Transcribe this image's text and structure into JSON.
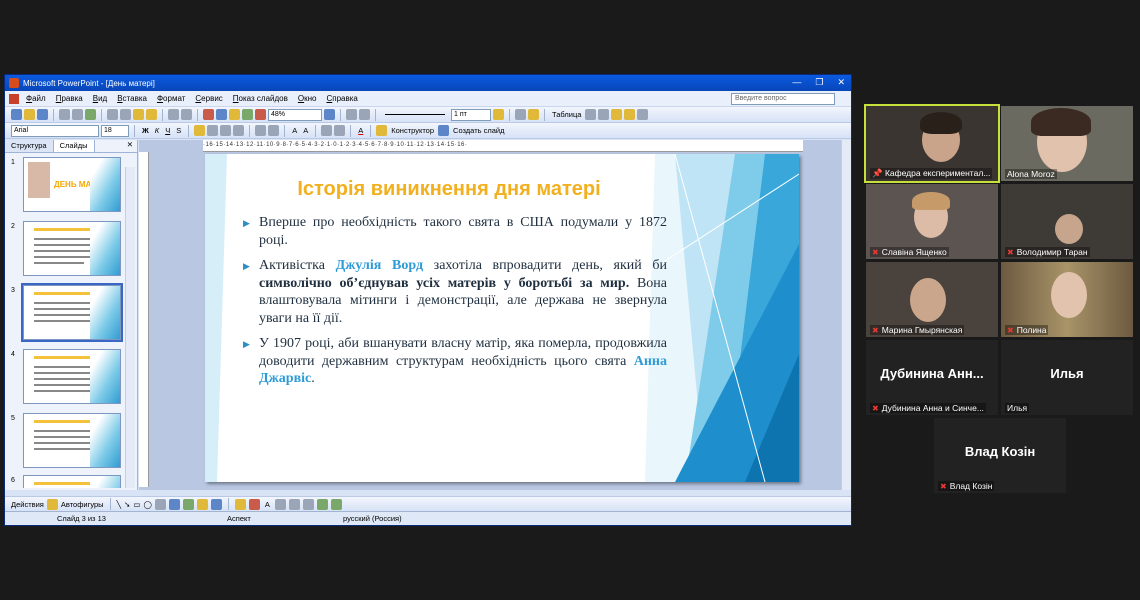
{
  "window": {
    "title": "Microsoft PowerPoint - [День матері]",
    "help_placeholder": "Введите вопрос"
  },
  "menu": [
    "Файл",
    "Правка",
    "Вид",
    "Вставка",
    "Формат",
    "Сервис",
    "Показ слайдов",
    "Окно",
    "Справка"
  ],
  "toolbar": {
    "zoom": "48%",
    "line_weight": "1 пт",
    "table_label": "Таблица",
    "font_name": "Arial",
    "font_size": "18",
    "constructor_label": "Конструктор",
    "new_slide_label": "Создать слайд"
  },
  "panel": {
    "tab_outline": "Структура",
    "tab_slides": "Слайды",
    "close": "✕",
    "thumb1_title": "ДЕНЬ МАТЕРІ",
    "thumb_numbers": [
      "1",
      "2",
      "3",
      "4",
      "5",
      "6"
    ]
  },
  "ruler": "·16·15·14·13·12·11·10·9·8·7·6·5·4·3·2·1·0·1·2·3·4·5·6·7·8·9·10·11·12·13·14·15·16·",
  "slide": {
    "title": "Історія виникнення дня матері",
    "b1": "Вперше про необхідність такого свята в США подумали у 1872 році.",
    "b2_pre": "Активістка ",
    "b2_name": "Джулія Ворд",
    "b2_mid": " захотіла впровадити день, який би ",
    "b2_bold": "символічно об’єднував усіх матерів у боротьбі за мир.",
    "b2_post": " Вона влаштовувала мітинги і демонстрації, але держава не звернула уваги на її дії.",
    "b3_pre": "У 1907 році, аби вшанувати власну матір, яка померла, продовжила доводити державним структурам необхідність цього свята ",
    "b3_name": "Анна Джарвіс",
    "b3_post": "."
  },
  "drawbar": {
    "actions": "Действия",
    "autoshapes": "Автофигуры"
  },
  "status": {
    "slide": "Слайд 3 из 13",
    "design": "Аспект",
    "language": "русский (Россия)"
  },
  "participants": [
    {
      "name": "Кафедра експериментал..."
    },
    {
      "name": "Alona Moroz"
    },
    {
      "name": "Славіна Ященко"
    },
    {
      "name": "Володимир Таран"
    },
    {
      "name": "Марина Гмырянская"
    },
    {
      "name": "Полина"
    },
    {
      "name": "Дубинина Анна и Синче...",
      "big": "Дубинина Анн..."
    },
    {
      "name": "Илья",
      "big": "Илья"
    },
    {
      "name": "Влад Козін",
      "big": "Влад Козін"
    }
  ]
}
